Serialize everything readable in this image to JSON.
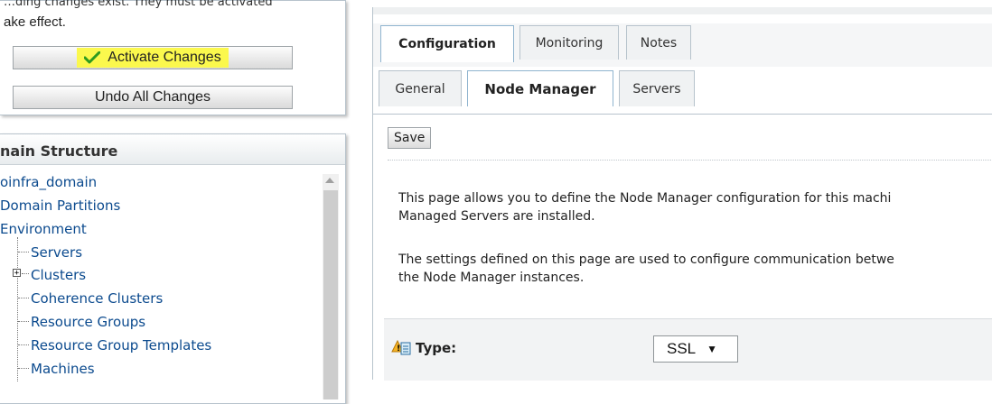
{
  "change_center": {
    "clipped_line": "…ding changes exist. They must be activated",
    "tail_text": "ake effect.",
    "activate_label": "Activate Changes",
    "undo_label": "Undo All Changes"
  },
  "domain_structure": {
    "title": "nain Structure",
    "tree": [
      "oinfra_domain",
      "Domain Partitions",
      "Environment",
      "Servers",
      "Clusters",
      "Coherence Clusters",
      "Resource Groups",
      "Resource Group Templates",
      "Machines"
    ],
    "expander_symbol": "+"
  },
  "tabs": {
    "main": [
      "Configuration",
      "Monitoring",
      "Notes"
    ],
    "sub": [
      "General",
      "Node Manager",
      "Servers"
    ]
  },
  "save_label": "Save",
  "description": {
    "p1_line1": "This page allows you to define the Node Manager configuration for this machi",
    "p1_line2": "Managed Servers are installed.",
    "p2_line1": "The settings defined on this page are used to configure communication betwe",
    "p2_line2": "the Node Manager instances."
  },
  "type_field": {
    "label": "Type:",
    "value": "SSL",
    "caret": "▼"
  },
  "colors": {
    "highlight": "#fbf84d",
    "link": "#0b4a8e",
    "border": "#b7c3cc"
  },
  "icons": {
    "check": "check-icon",
    "help": "warning-help-icon",
    "expander": "plus-box-icon"
  }
}
